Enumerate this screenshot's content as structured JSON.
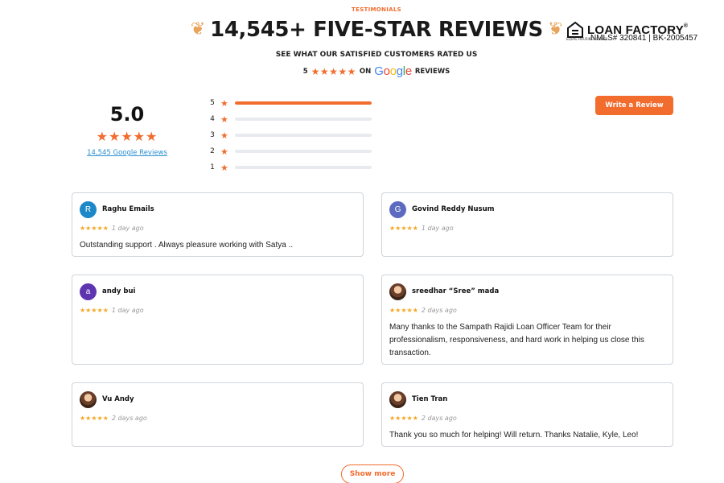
{
  "header": {
    "eyebrow": "TESTIMONIALS",
    "title": "14,545+ FIVE-STAR REVIEWS",
    "subtitle": "SEE WHAT OUR SATISFIED CUSTOMERS RATED US",
    "rated_number": "5",
    "rated_stars": "★★★★★",
    "rated_on": "ON",
    "google": [
      "G",
      "o",
      "o",
      "g",
      "l",
      "e"
    ],
    "rated_suffix": "REVIEWS"
  },
  "brand": {
    "name": "LOAN FACTORY",
    "reg": "®",
    "nmls": "NMLS# 320841 | BK-2005457",
    "lender_text": "EQUAL HOUSING LENDER",
    "icon": "equal-housing-icon"
  },
  "summary": {
    "score": "5.0",
    "stars": "★★★★★",
    "reviews_link": "14,545 Google Reviews"
  },
  "distribution": [
    {
      "label": "5",
      "fraction": 1.0
    },
    {
      "label": "4",
      "fraction": 0.0
    },
    {
      "label": "3",
      "fraction": 0.0
    },
    {
      "label": "2",
      "fraction": 0.0
    },
    {
      "label": "1",
      "fraction": 0.0
    }
  ],
  "write_review_label": "Write a Review",
  "reviews": [
    {
      "name": "Raghu Emails",
      "initial": "R",
      "avatar_color": "#1d88c8",
      "stars": "★★★★★",
      "date": "1 day ago",
      "text": "Outstanding support . Always pleasure working with Satya .."
    },
    {
      "name": "Govind Reddy Nusum",
      "initial": "G",
      "avatar_color": "#5c6bc0",
      "stars": "★★★★★",
      "date": "1 day ago",
      "text": ""
    },
    {
      "name": "andy bui",
      "initial": "a",
      "avatar_color": "#5e35b1",
      "stars": "★★★★★",
      "date": "1 day ago",
      "text": ""
    },
    {
      "name": "sreedhar “Sree” mada",
      "initial": "",
      "avatar_color": "",
      "stars": "★★★★★",
      "date": "2 days ago",
      "text": "Many thanks to the Sampath Rajidi Loan Officer Team for their professionalism, responsiveness, and hard work in helping us close this transaction."
    },
    {
      "name": "Vu Andy",
      "initial": "",
      "avatar_color": "",
      "stars": "★★★★★",
      "date": "2 days ago",
      "text": ""
    },
    {
      "name": "Tien Tran",
      "initial": "",
      "avatar_color": "",
      "stars": "★★★★★",
      "date": "2 days ago",
      "text": "Thank you so much for helping! Will return. Thanks Natalie, Kyle, Leo!"
    }
  ],
  "show_more_label": "Show more",
  "colors": {
    "accent": "#f26c2e",
    "link": "#2a8fd1",
    "card_border": "#cfd4da"
  }
}
